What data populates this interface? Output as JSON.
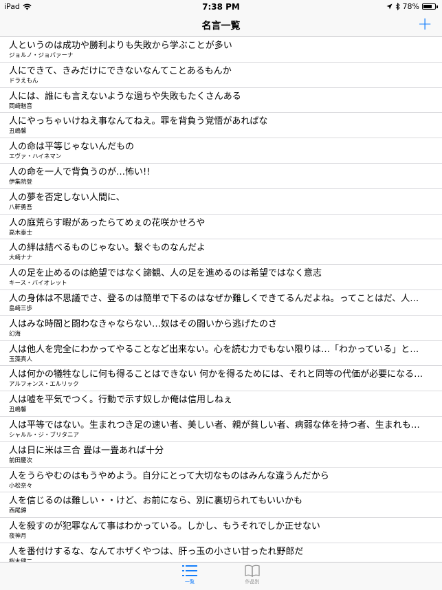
{
  "status_bar": {
    "device": "iPad",
    "time": "7:38 PM",
    "battery_percent": "78%",
    "battery_level": 0.78
  },
  "nav": {
    "title": "名言一覧",
    "add_label": "+"
  },
  "colors": {
    "accent": "#147efb",
    "bar_background": "#f8f8f8",
    "separator": "#d9d9dd",
    "inactive_tab": "#929292"
  },
  "quotes": [
    {
      "quote": "人というのは成功や勝利よりも失敗から学ぶことが多い",
      "author": "ジョルノ・ジョバァーナ"
    },
    {
      "quote": "人にできて、きみだけにできないなんてことあるもんか",
      "author": "ドラえもん"
    },
    {
      "quote": "人には、誰にも言えないような過ちや失敗もたくさんある",
      "author": "岡崎魅音"
    },
    {
      "quote": "人にやっちゃいけねえ事なんてねえ。罪を背負う覚悟があればな",
      "author": "丑嶋馨"
    },
    {
      "quote": "人の命は平等じゃないんだもの",
      "author": "エヴァ・ハイネマン"
    },
    {
      "quote": "人の命を一人で背負うのが…怖い!!",
      "author": "伊集院登"
    },
    {
      "quote": "人の夢を否定しない人間に、",
      "author": "八軒勇吾"
    },
    {
      "quote": "人の庭荒らす暇があったらてめぇの花咲かせろや",
      "author": "高木泰士"
    },
    {
      "quote": "人の絆は結べるものじゃない。繋ぐものなんだよ",
      "author": "大崎ナナ"
    },
    {
      "quote": "人の足を止めるのは絶望ではなく諦観、人の足を進めるのは希望ではなく意志",
      "author": "キース・バイオレット"
    },
    {
      "quote": "人の身体は不思議でさ、登るのは簡単で下るのはなぜか難しくできてるんだよね。ってことはだ、人…",
      "author": "島崎三歩"
    },
    {
      "quote": "人はみな時間と闘わなきゃならない…奴はその闘いから逃げたのさ",
      "author": "幻海"
    },
    {
      "quote": "人は他人を完全にわかってやることなど出来ない。心を読む力でもない限りは…「わかっている」と…",
      "author": "玉藻真人"
    },
    {
      "quote": "人は何かの犠牲なしに何も得ることはできない 何かを得るためには、それと同等の代価が必要になる…",
      "author": "アルフォンス・エルリック"
    },
    {
      "quote": "人は嘘を平気でつく。行動で示す奴しか俺は信用しねぇ",
      "author": "丑嶋馨"
    },
    {
      "quote": "人は平等ではない。生まれつき足の速い者、美しい者、親が貧しい者、病弱な体を持つ者、生まれも…",
      "author": "シャルル・ジ・ブリタニア"
    },
    {
      "quote": "人は日に米は三合 畳は一畳あれば十分",
      "author": "前田慶次"
    },
    {
      "quote": "人をうらやむのはもうやめよう。自分にとって大切なものはみんな違うんだから",
      "author": "小松奈々"
    },
    {
      "quote": "人を信じるのは難しい・・けど、お前になら、別に裏切られてもいいかも",
      "author": "西尾錦"
    },
    {
      "quote": "人を殺すのが犯罪なんて事はわかっている。しかし、もうそれでしか正せない",
      "author": "夜神月"
    },
    {
      "quote": "人を番付けするな、なんてホザくやつは、肝っ玉の小さい甘ったれ野郎だ",
      "author": "桜木健二"
    }
  ],
  "tabs": [
    {
      "label": "一覧",
      "icon": "list-icon"
    },
    {
      "label": "作品別",
      "icon": "book-icon"
    }
  ]
}
